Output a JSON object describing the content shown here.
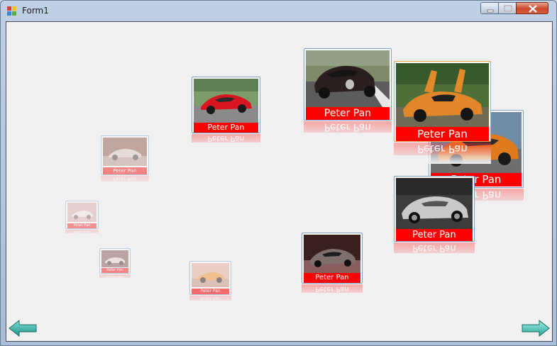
{
  "window": {
    "title": "Form1"
  },
  "gallery": {
    "cards": [
      {
        "id": "far-left-small",
        "label": "Peter Pan",
        "photo": "silver-sports-car-icon",
        "faded": true
      },
      {
        "id": "left-small-2",
        "label": "Peter Pan",
        "photo": "white-sports-car-icon",
        "faded": true
      },
      {
        "id": "left-tiny",
        "label": "Peter Pan",
        "photo": "silver-supercar-icon",
        "faded": true
      },
      {
        "id": "orange-small",
        "label": "Peter Pan",
        "photo": "orange-sports-car-icon",
        "faded": true
      },
      {
        "id": "red-ferrari",
        "label": "Peter Pan",
        "photo": "red-ferrari-icon",
        "faded": false
      },
      {
        "id": "bugatti",
        "label": "Peter Pan",
        "photo": "black-bugatti-icon",
        "faded": false
      },
      {
        "id": "orange-lambo",
        "label": "Peter Pan",
        "photo": "orange-lamborghini-icon",
        "faded": false
      },
      {
        "id": "orange-behind",
        "label": "Peter Pan",
        "photo": "orange-car-icon",
        "faded": false
      },
      {
        "id": "silver-porsche",
        "label": "Peter Pan",
        "photo": "silver-porsche-icon",
        "faded": false
      },
      {
        "id": "pagani",
        "label": "Peter Pan",
        "photo": "pagani-zonda-icon",
        "faded": false
      }
    ]
  },
  "nav": {
    "prev_icon": "left-arrow-icon",
    "next_icon": "right-arrow-icon"
  },
  "colors": {
    "label_red": "#ff0000",
    "accent_gold": "#e1a24b",
    "frame_blue": "#7fa1c8"
  }
}
